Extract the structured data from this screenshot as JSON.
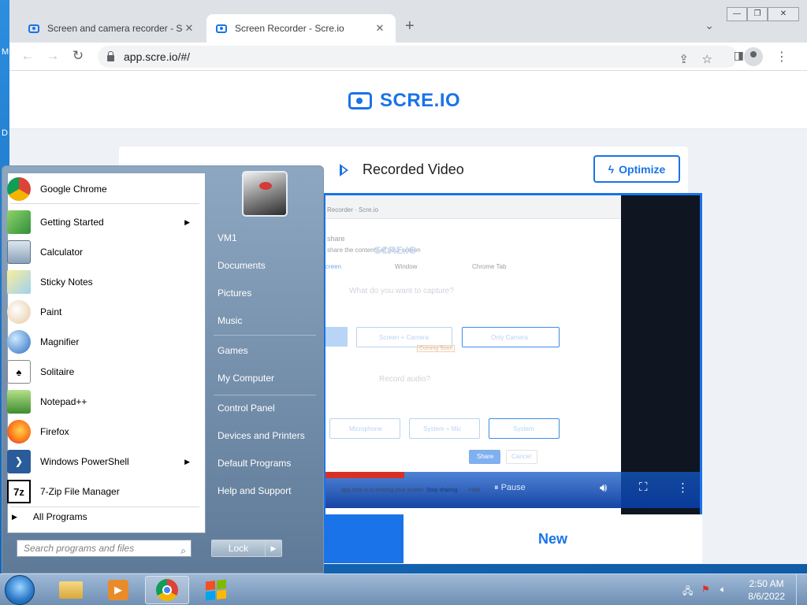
{
  "desktop": {
    "letters": [
      "M",
      "D"
    ]
  },
  "browser": {
    "tabs": [
      {
        "title": "Screen and camera recorder - Scr",
        "active": false
      },
      {
        "title": "Screen Recorder - Scre.io",
        "active": true
      }
    ],
    "url": "app.scre.io/#/"
  },
  "site": {
    "logo": "SCRE.IO",
    "recorded_title": "Recorded Video",
    "optimize_label": "Optimize",
    "new_label": "New",
    "video": {
      "ghost_texts": {
        "tab": "Recorder · Scre.io",
        "share": "share",
        "share_desc": "share the contents of your screen",
        "logo": "SCRE.IO",
        "tab_screen": "creen",
        "tab_window": "Window",
        "tab_chrome": "Chrome Tab",
        "capture_q": "What do you want to capture?",
        "screen_camera": "Screen + Camera",
        "coming_soon": "Coming Soon",
        "only_camera": "Only Camera",
        "record_audio": "Record audio?",
        "microphone": "Microphone",
        "system_mic": "System + Mic",
        "system": "System",
        "share_btn": "Share",
        "cancel_btn": "Cancel",
        "sharing_bar": "app.scre.io is sharing your screen",
        "stop_sharing": "Stop sharing",
        "hide": "Hide"
      },
      "pause_label": "Pause"
    }
  },
  "startmenu": {
    "programs": [
      {
        "label": "Google Chrome",
        "icon": "chrome-icon",
        "has_submenu": false
      },
      {
        "label": "Getting Started",
        "icon": "getting-started-icon",
        "has_submenu": true
      },
      {
        "label": "Calculator",
        "icon": "calculator-icon",
        "has_submenu": false
      },
      {
        "label": "Sticky Notes",
        "icon": "sticky-notes-icon",
        "has_submenu": false
      },
      {
        "label": "Paint",
        "icon": "paint-icon",
        "has_submenu": false
      },
      {
        "label": "Magnifier",
        "icon": "magnifier-icon",
        "has_submenu": false
      },
      {
        "label": "Solitaire",
        "icon": "solitaire-icon",
        "has_submenu": false
      },
      {
        "label": "Notepad++",
        "icon": "notepadpp-icon",
        "has_submenu": false
      },
      {
        "label": "Firefox",
        "icon": "firefox-icon",
        "has_submenu": false
      },
      {
        "label": "Windows PowerShell",
        "icon": "powershell-icon",
        "has_submenu": true
      },
      {
        "label": "7-Zip File Manager",
        "icon": "7zip-icon",
        "has_submenu": false
      }
    ],
    "all_programs": "All Programs",
    "search_placeholder": "Search programs and files",
    "right_links": [
      "VM1",
      "Documents",
      "Pictures",
      "Music",
      "Games",
      "My Computer",
      "Control Panel",
      "Devices and Printers",
      "Default Programs",
      "Help and Support"
    ],
    "lock_label": "Lock"
  },
  "taskbar": {
    "time": "2:50 AM",
    "date": "8/6/2022"
  }
}
